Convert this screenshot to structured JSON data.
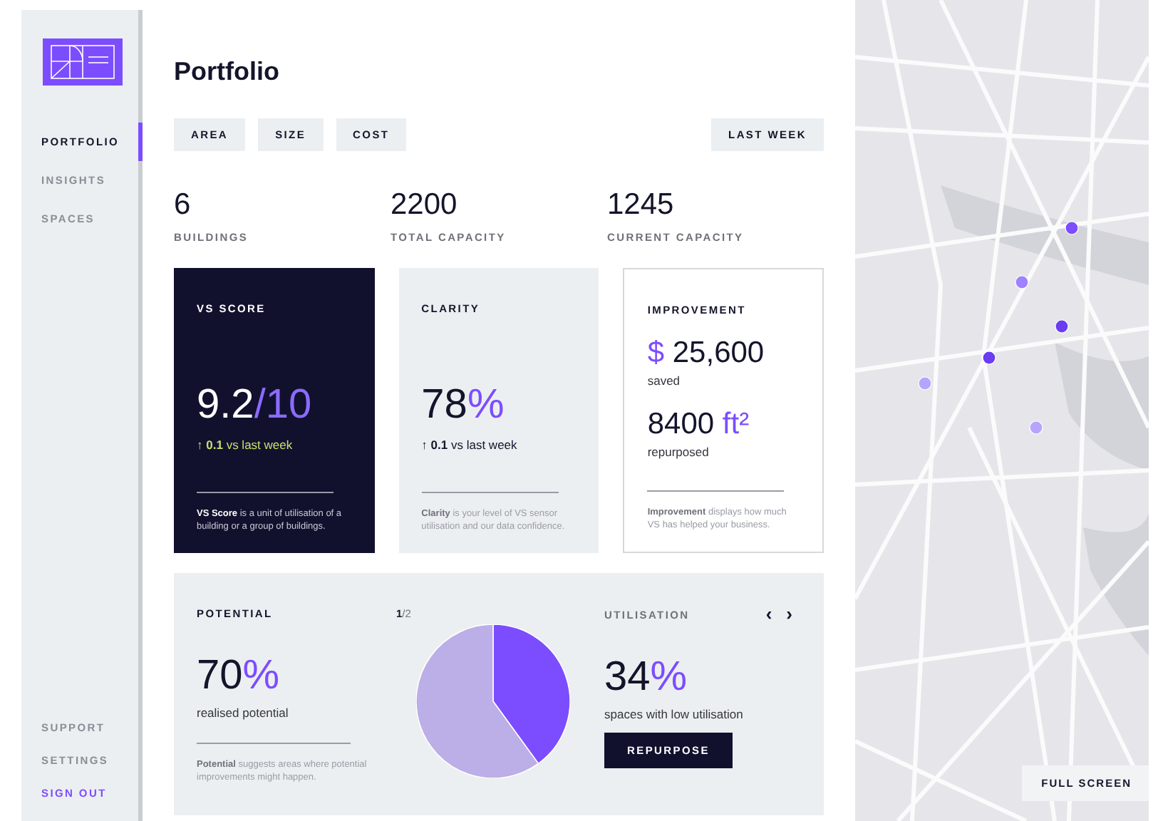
{
  "sidebar": {
    "nav": [
      {
        "label": "PORTFOLIO",
        "selected": true
      },
      {
        "label": "INSIGHTS",
        "selected": false
      },
      {
        "label": "SPACES",
        "selected": false
      }
    ],
    "footer": [
      {
        "label": "SUPPORT",
        "kind": "plain"
      },
      {
        "label": "SETTINGS",
        "kind": "plain"
      },
      {
        "label": "SIGN OUT",
        "kind": "accent"
      }
    ]
  },
  "page": {
    "title": "Portfolio",
    "filters": [
      {
        "label": "AREA"
      },
      {
        "label": "SIZE"
      },
      {
        "label": "COST"
      }
    ],
    "period": "LAST WEEK",
    "stats": [
      {
        "value": "6",
        "label": "BUILDINGS"
      },
      {
        "value": "2200",
        "label": "TOTAL CAPACITY"
      },
      {
        "value": "1245",
        "label": "CURRENT CAPACITY"
      }
    ],
    "cards": [
      {
        "kind": "dark",
        "title": "VS SCORE",
        "metrics": [
          {
            "value": "9.2",
            "unit": "/10"
          }
        ],
        "change": "↑ **0.1** vs last week",
        "description": "**VS Score** is a unit of utilisation of a building or a group of buildings."
      },
      {
        "kind": "grey",
        "title": "CLARITY",
        "metrics": [
          {
            "value": "78",
            "unit": "%"
          }
        ],
        "change": "↑ **0.1** vs last week",
        "description": "**Clarity** is your level of VS sensor utilisation and our data confidence."
      },
      {
        "kind": "outline",
        "title": "IMPROVEMENT",
        "metrics": [
          {
            "prefix": "$",
            "value": "25,600",
            "caption": "saved"
          },
          {
            "value": "8400",
            "unit": "ft²",
            "caption": "repurposed"
          }
        ],
        "description": "**Improvement** displays how much VS has helped your business."
      }
    ],
    "potential": {
      "title": "POTENTIAL",
      "value": "70",
      "unit": "%",
      "caption": "realised potential",
      "description": "**Potential** suggests areas where potential improvements might happen."
    },
    "pager": "**1**/2",
    "utilisation": {
      "title": "UTILISATION",
      "value": "34",
      "unit": "%",
      "caption": "spaces with low utilisation",
      "button": "REPURPOSE",
      "arrows": [
        "‹",
        "›"
      ]
    }
  },
  "map": {
    "button": "FULL SCREEN"
  }
}
